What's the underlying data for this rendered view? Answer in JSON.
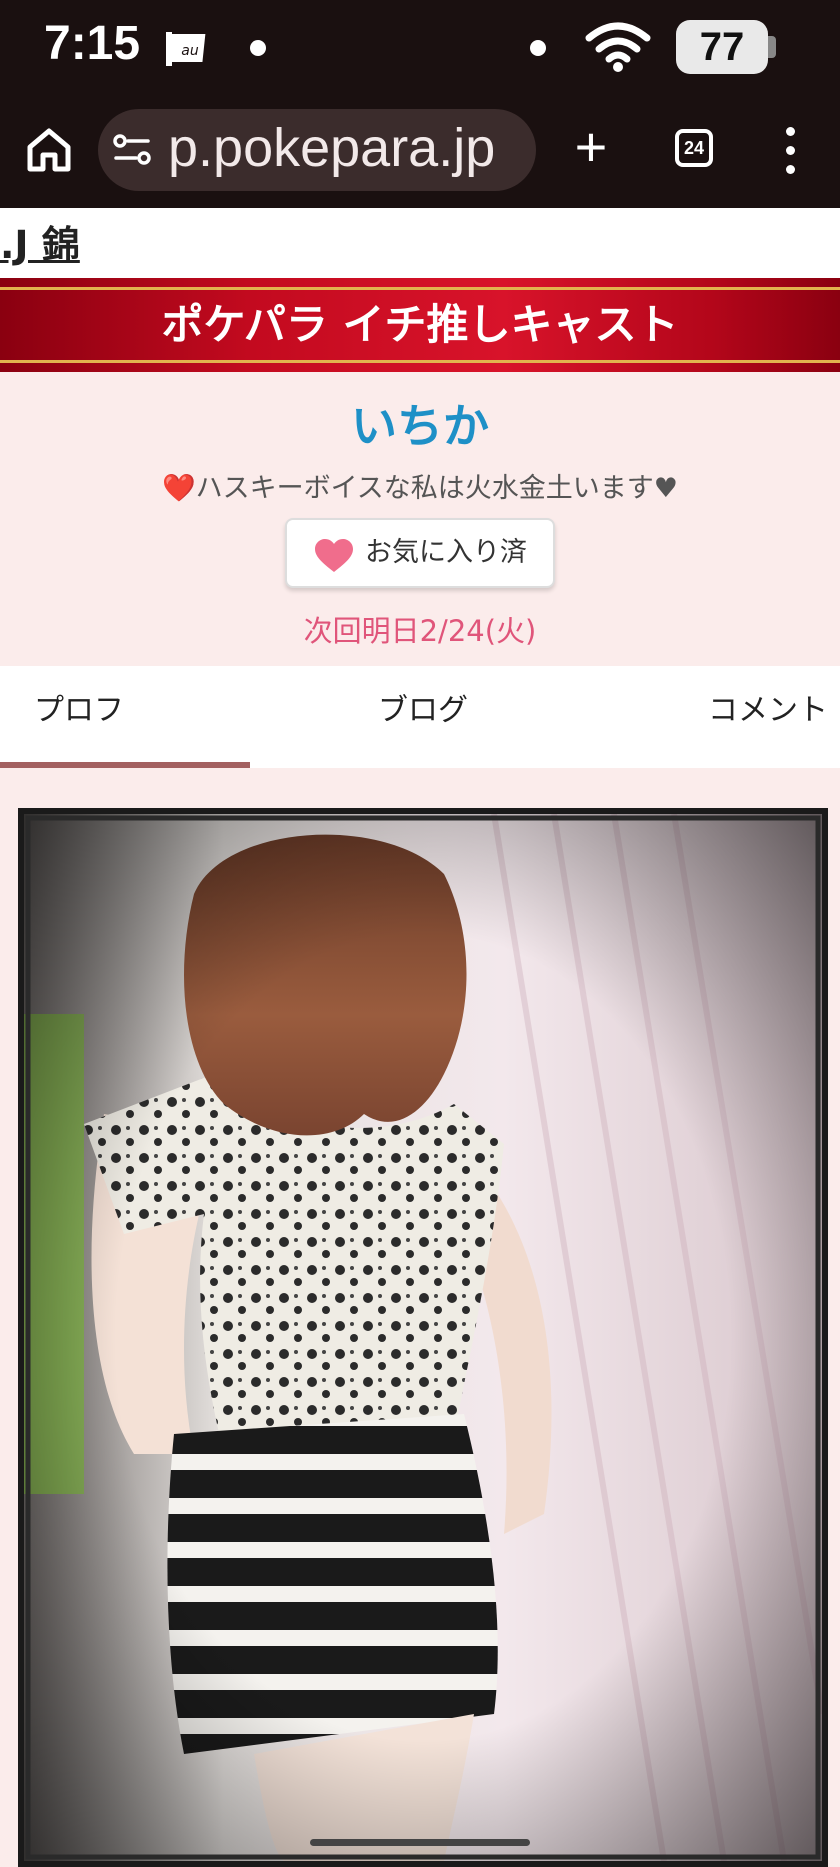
{
  "status_bar": {
    "time": "7:15",
    "carrier": "au",
    "battery_percent": "77",
    "icons": [
      "carrier-icon",
      "dot",
      "dot",
      "wifi-icon",
      "battery-icon"
    ]
  },
  "browser": {
    "url": "p.pokepara.jp",
    "new_tab_symbol": "+",
    "tab_count": "24",
    "icons": [
      "home-icon",
      "site-info-icon",
      "plus-icon",
      "tabs-icon",
      "more-vert-icon"
    ]
  },
  "page": {
    "top_link": ".J 錦",
    "banner_title": "ポケパラ イチ推しキャスト",
    "cast": {
      "name": "いちか",
      "catchphrase": "❤️ハスキーボイスな私は火水金土います♥",
      "favorite_label": "お気に入り済",
      "next_shift": "次回明日2/24(火)"
    },
    "tabs": [
      {
        "label": "プロフ",
        "active": true
      },
      {
        "label": "ブログ",
        "active": false
      },
      {
        "label": "コメント",
        "active": false
      }
    ]
  },
  "colors": {
    "status_bar_bg": "#1a1010",
    "banner_red": "#c30a1f",
    "banner_gold_line": "#e2b34e",
    "profile_bg": "#fbeceb",
    "name_blue": "#1e90c7",
    "date_pink": "#e0557a",
    "heart_pink": "#f06d8c",
    "tab_underline": "#a36060"
  }
}
